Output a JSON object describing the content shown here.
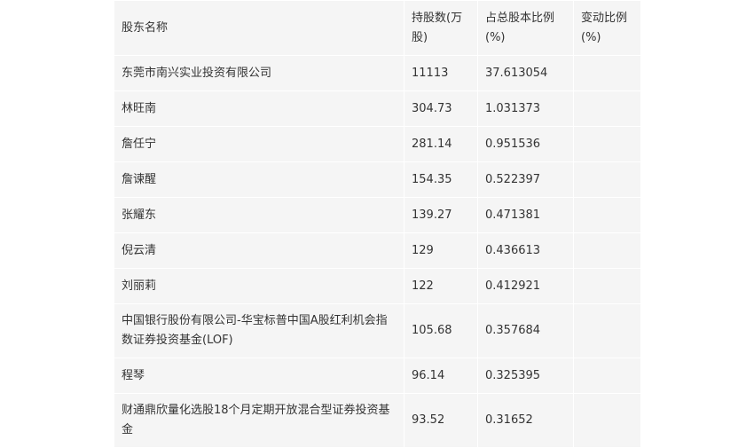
{
  "table": {
    "headers": [
      "股东名称",
      "持股数(万股)",
      "占总股本比例(%)",
      "变动比例(%)"
    ],
    "rows": [
      {
        "name": "东莞市南兴实业投资有限公司",
        "shares": "11113",
        "ratio": "37.613054",
        "change": ""
      },
      {
        "name": "林旺南",
        "shares": "304.73",
        "ratio": "1.031373",
        "change": ""
      },
      {
        "name": "詹任宁",
        "shares": "281.14",
        "ratio": "0.951536",
        "change": ""
      },
      {
        "name": "詹谏醒",
        "shares": "154.35",
        "ratio": "0.522397",
        "change": ""
      },
      {
        "name": "张耀东",
        "shares": "139.27",
        "ratio": "0.471381",
        "change": ""
      },
      {
        "name": "倪云清",
        "shares": "129",
        "ratio": "0.436613",
        "change": ""
      },
      {
        "name": "刘丽莉",
        "shares": "122",
        "ratio": "0.412921",
        "change": ""
      },
      {
        "name": "中国银行股份有限公司-华宝标普中国A股红利机会指数证券投资基金(LOF)",
        "shares": "105.68",
        "ratio": "0.357684",
        "change": ""
      },
      {
        "name": "程琴",
        "shares": "96.14",
        "ratio": "0.325395",
        "change": ""
      },
      {
        "name": "财通鼎欣量化选股18个月定期开放混合型证券投资基金",
        "shares": "93.52",
        "ratio": "0.31652",
        "change": ""
      }
    ]
  }
}
